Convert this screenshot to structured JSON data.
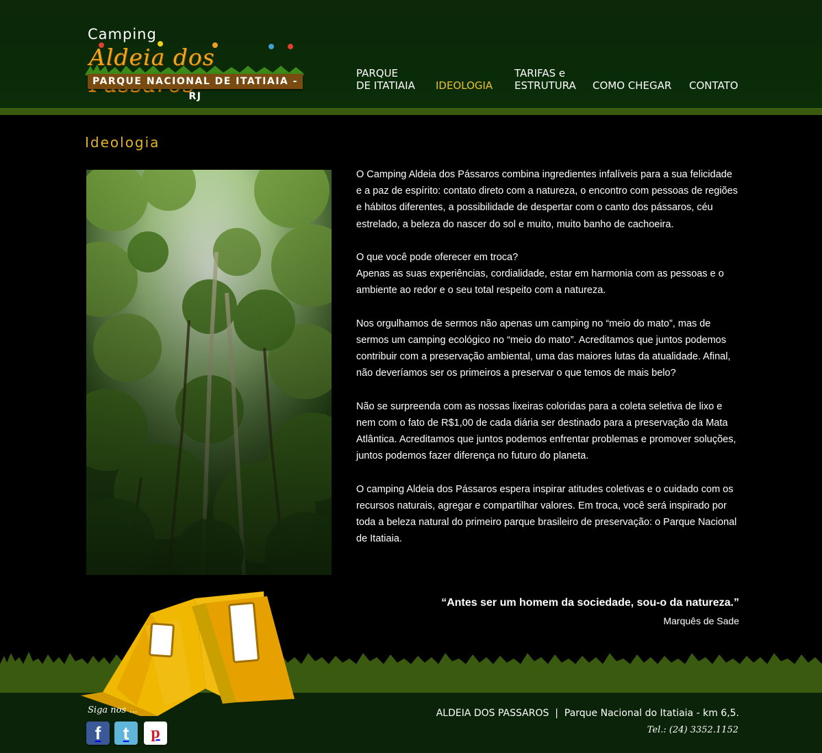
{
  "logo": {
    "camping": "Camping",
    "title": "Aldeia dos Pássaros",
    "subtitle": "PARQUE NACIONAL DE ITATIAIA - RJ"
  },
  "nav": {
    "items": [
      {
        "line1": "PARQUE",
        "line2": "DE ITATIAIA",
        "active": false
      },
      {
        "line1": "",
        "line2": "IDEOLOGIA",
        "active": true
      },
      {
        "line1": "TARIFAS e",
        "line2": "ESTRUTURA",
        "active": false
      },
      {
        "line1": "",
        "line2": "COMO CHEGAR",
        "active": false
      },
      {
        "line1": "",
        "line2": "CONTATO",
        "active": false
      }
    ]
  },
  "page": {
    "title": "Ideologia"
  },
  "content": {
    "p1": "O Camping Aldeia dos Pássaros combina ingredientes infalíveis para a sua felicidade e a paz de espírito: contato direto com a natureza, o encontro com pessoas de regiões e hábitos diferentes, a possibilidade de despertar com o canto dos pássaros, céu estrelado, a beleza do nascer do sol e muito, muito banho de cachoeira.",
    "p2a": "O que você pode oferecer em troca?",
    "p2b": "Apenas as suas experiências, cordialidade, estar em harmonia com as pessoas e o ambiente ao redor e o seu total respeito com a natureza.",
    "p3": "Nos orgulhamos de sermos não apenas um camping no “meio do mato”, mas de sermos um camping ecológico no “meio do mato”. Acreditamos que juntos podemos contribuir com a preservação ambiental, uma das maiores lutas da atualidade. Afinal, não deveríamos ser os primeiros a preservar o que temos de mais belo?",
    "p4": "Não se surpreenda com as nossas lixeiras coloridas para a coleta seletiva de lixo e nem com o fato de R$1,00 de cada diária ser destinado para a preservação da Mata Atlântica. Acreditamos que juntos podemos enfrentar problemas e promover soluções, juntos podemos fazer diferença no futuro do planeta.",
    "p5": "O camping Aldeia dos Pássaros espera inspirar atitudes coletivas e o cuidado com os recursos naturais, agregar e compartilhar valores. Em troca, você será inspirado por toda a beleza natural do primeiro parque brasileiro de preservação: o Parque Nacional de Itatiaia."
  },
  "quote": {
    "text": "“Antes ser um homem da sociedade, sou-o da natureza.”",
    "author": "Marquês de Sade"
  },
  "footer": {
    "follow": "Siga nos ...",
    "social": [
      {
        "name": "facebook",
        "glyph": "f",
        "color": "#3b5998"
      },
      {
        "name": "twitter",
        "glyph": "t",
        "color": "#5fb6d9"
      },
      {
        "name": "pinterest",
        "glyph": "p",
        "color": "#ffffff"
      }
    ],
    "address": "ALDEIA DOS PASSAROS  |  Parque Nacional do Itatiaia - km 6,5.",
    "tel": "Tel.: (24) 3352.1152"
  },
  "colors": {
    "header_green": "#0a2a08",
    "accent_gold": "#e3b423",
    "grass_green": "#3a5a10",
    "tent_yellow": "#e8b400"
  }
}
